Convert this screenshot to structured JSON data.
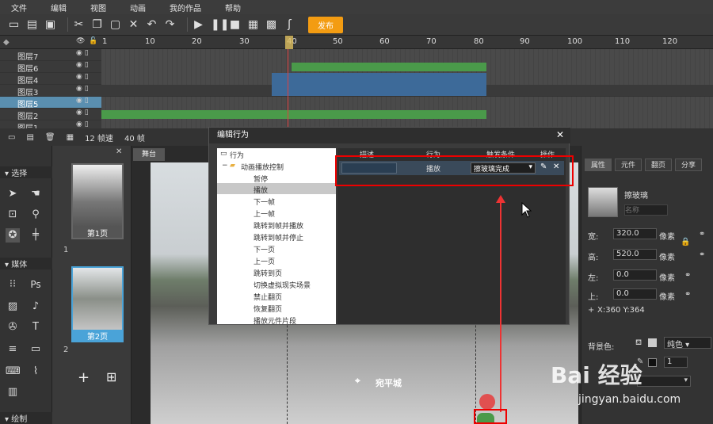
{
  "menu": [
    "文件",
    "编辑",
    "视图",
    "动画",
    "我的作品",
    "帮助"
  ],
  "toolbar": {
    "publish_label": "发布"
  },
  "ruler": {
    "ticks": [
      "1",
      "10",
      "20",
      "30",
      "40",
      "50",
      "60",
      "70",
      "80",
      "90",
      "100",
      "110",
      "120"
    ]
  },
  "layers": [
    {
      "name": "图层7"
    },
    {
      "name": "图层6"
    },
    {
      "name": "图层4"
    },
    {
      "name": "图层3"
    },
    {
      "name": "图层5"
    },
    {
      "name": "图层2"
    },
    {
      "name": "图层1"
    }
  ],
  "timeline_status": {
    "fps": "12 帧速",
    "frames": "40 帧"
  },
  "left_panel": {
    "select_section": "选择",
    "media_section": "媒体",
    "draw_section": "绘制"
  },
  "pages": [
    {
      "index": "1",
      "label": "第1页"
    },
    {
      "index": "2",
      "label": "第2页"
    }
  ],
  "stage": {
    "tab": "舞台",
    "location_label": "宛平城"
  },
  "dialog": {
    "title": "编辑行为",
    "tree_root": "行为",
    "tree_group": "动画播放控制",
    "tree_items": [
      "暂停",
      "播放",
      "下一帧",
      "上一帧",
      "跳转到帧并播放",
      "跳转到帧并停止",
      "下一页",
      "上一页",
      "跳转到页",
      "切换虚拟现实场景",
      "禁止翻页",
      "恢复翻页",
      "播放元件片段"
    ],
    "columns": [
      "描述",
      "行为",
      "触发条件",
      "操作"
    ],
    "row": {
      "behavior": "播放",
      "trigger": "擦玻璃完成"
    }
  },
  "properties": {
    "tabs": [
      "属性",
      "元件",
      "翻页",
      "分享"
    ],
    "element_name": "擦玻璃",
    "name_placeholder": "名称",
    "width_label": "宽:",
    "width": "320.0",
    "height_label": "高:",
    "height": "520.0",
    "left_label": "左:",
    "left": "0.0",
    "top_label": "上:",
    "top": "0.0",
    "unit": "像素",
    "coords": "X:360   Y:364",
    "bg_label": "背景色:",
    "bg_value": "纯色",
    "opacity_value": "1"
  },
  "watermark": {
    "brand": "Bai 经验",
    "url": "jingyan.baidu.com"
  },
  "colors": {
    "accent": "#f39c12",
    "green_bar": "#4a9a4a",
    "blue_bar": "#3d6a99",
    "highlight": "#e00000"
  }
}
